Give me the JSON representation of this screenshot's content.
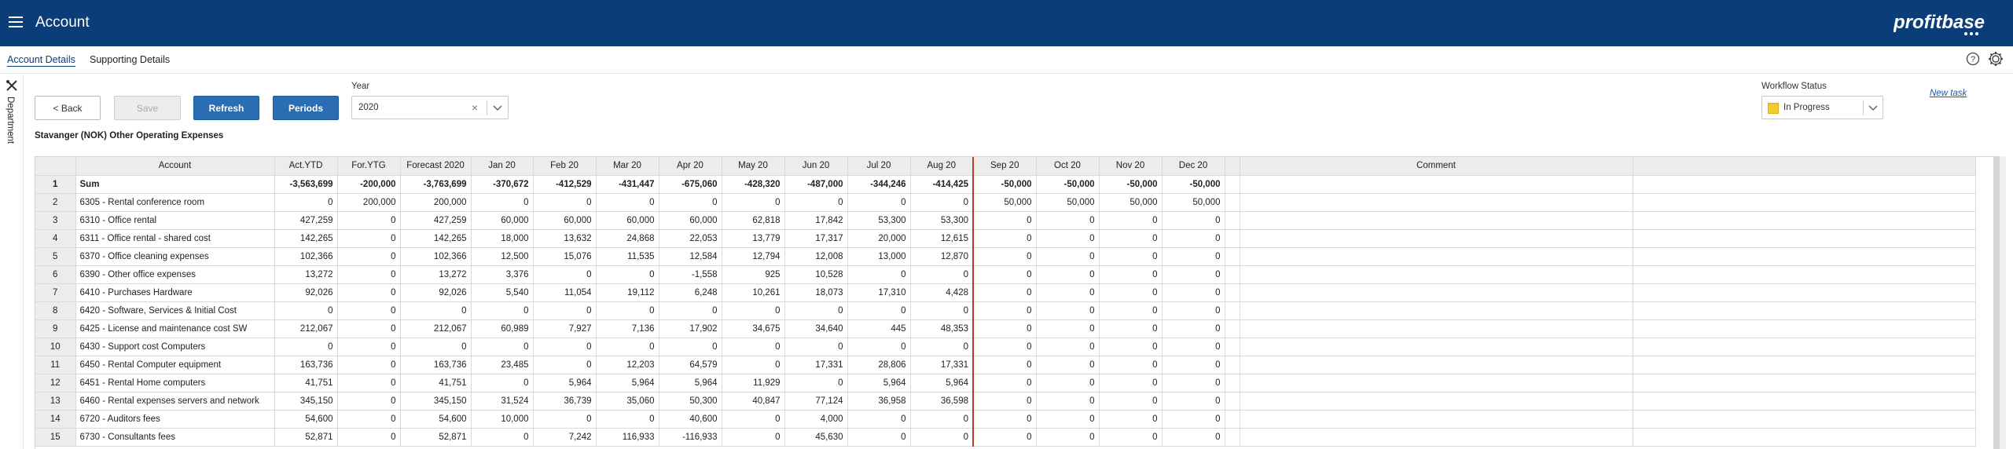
{
  "header": {
    "title": "Account",
    "logo_text": "profitbase"
  },
  "subnav": {
    "tabs": [
      {
        "label": "Account Details",
        "active": true
      },
      {
        "label": "Supporting Details",
        "active": false
      }
    ],
    "icons": [
      "help-icon",
      "gear-icon"
    ]
  },
  "sidepanel": {
    "icon": "tools-icon",
    "label": "Department"
  },
  "toolbar": {
    "back_label": "< Back",
    "save_label": "Save",
    "refresh_label": "Refresh",
    "periods_label": "Periods",
    "year_label": "Year",
    "year_value": "2020",
    "workflow_label": "Workflow Status",
    "workflow_value": "In Progress",
    "workflow_color": "#f2cb2c",
    "new_task_label": "New task"
  },
  "context": "Stavanger (NOK)  Other Operating Expenses",
  "colors": {
    "header_bg": "#0b3d78",
    "primary_button": "#2a6db3",
    "actuals_cutoff_line": "#c0392b"
  },
  "grid": {
    "columns": [
      "",
      "Account",
      "Act.YTD",
      "For.YTG",
      "Forecast 2020",
      "Jan 20",
      "Feb 20",
      "Mar 20",
      "Apr 20",
      "May 20",
      "Jun 20",
      "Jul 20",
      "Aug 20",
      "Sep 20",
      "Oct 20",
      "Nov 20",
      "Dec 20",
      "",
      "Comment",
      ""
    ],
    "rows": [
      [
        "1",
        "Sum",
        "-3,563,699",
        "-200,000",
        "-3,763,699",
        "-370,672",
        "-412,529",
        "-431,447",
        "-675,060",
        "-428,320",
        "-487,000",
        "-344,246",
        "-414,425",
        "-50,000",
        "-50,000",
        "-50,000",
        "-50,000",
        "",
        "",
        ""
      ],
      [
        "2",
        "6305 - Rental conference room",
        "0",
        "200,000",
        "200,000",
        "0",
        "0",
        "0",
        "0",
        "0",
        "0",
        "0",
        "0",
        "50,000",
        "50,000",
        "50,000",
        "50,000",
        "",
        "",
        ""
      ],
      [
        "3",
        "6310 - Office rental",
        "427,259",
        "0",
        "427,259",
        "60,000",
        "60,000",
        "60,000",
        "60,000",
        "62,818",
        "17,842",
        "53,300",
        "53,300",
        "0",
        "0",
        "0",
        "0",
        "",
        "",
        ""
      ],
      [
        "4",
        "6311 - Office rental - shared cost",
        "142,265",
        "0",
        "142,265",
        "18,000",
        "13,632",
        "24,868",
        "22,053",
        "13,779",
        "17,317",
        "20,000",
        "12,615",
        "0",
        "0",
        "0",
        "0",
        "",
        "",
        ""
      ],
      [
        "5",
        "6370 - Office cleaning expenses",
        "102,366",
        "0",
        "102,366",
        "12,500",
        "15,076",
        "11,535",
        "12,584",
        "12,794",
        "12,008",
        "13,000",
        "12,870",
        "0",
        "0",
        "0",
        "0",
        "",
        "",
        ""
      ],
      [
        "6",
        "6390 - Other office expenses",
        "13,272",
        "0",
        "13,272",
        "3,376",
        "0",
        "0",
        "-1,558",
        "925",
        "10,528",
        "0",
        "0",
        "0",
        "0",
        "0",
        "0",
        "",
        "",
        ""
      ],
      [
        "7",
        "6410 - Purchases Hardware",
        "92,026",
        "0",
        "92,026",
        "5,540",
        "11,054",
        "19,112",
        "6,248",
        "10,261",
        "18,073",
        "17,310",
        "4,428",
        "0",
        "0",
        "0",
        "0",
        "",
        "",
        ""
      ],
      [
        "8",
        "6420 - Software, Services & Initial Cost",
        "0",
        "0",
        "0",
        "0",
        "0",
        "0",
        "0",
        "0",
        "0",
        "0",
        "0",
        "0",
        "0",
        "0",
        "0",
        "",
        "",
        ""
      ],
      [
        "9",
        "6425 - License and maintenance cost SW",
        "212,067",
        "0",
        "212,067",
        "60,989",
        "7,927",
        "7,136",
        "17,902",
        "34,675",
        "34,640",
        "445",
        "48,353",
        "0",
        "0",
        "0",
        "0",
        "",
        "",
        ""
      ],
      [
        "10",
        "6430 - Support cost Computers",
        "0",
        "0",
        "0",
        "0",
        "0",
        "0",
        "0",
        "0",
        "0",
        "0",
        "0",
        "0",
        "0",
        "0",
        "0",
        "",
        "",
        ""
      ],
      [
        "11",
        "6450 - Rental Computer equipment",
        "163,736",
        "0",
        "163,736",
        "23,485",
        "0",
        "12,203",
        "64,579",
        "0",
        "17,331",
        "28,806",
        "17,331",
        "0",
        "0",
        "0",
        "0",
        "",
        "",
        ""
      ],
      [
        "12",
        "6451 - Rental Home computers",
        "41,751",
        "0",
        "41,751",
        "0",
        "5,964",
        "5,964",
        "5,964",
        "11,929",
        "0",
        "5,964",
        "5,964",
        "0",
        "0",
        "0",
        "0",
        "",
        "",
        ""
      ],
      [
        "13",
        "6460 - Rental expenses servers and network",
        "345,150",
        "0",
        "345,150",
        "31,524",
        "36,739",
        "35,060",
        "50,300",
        "40,847",
        "77,124",
        "36,958",
        "36,598",
        "0",
        "0",
        "0",
        "0",
        "",
        "",
        ""
      ],
      [
        "14",
        "6720 - Auditors fees",
        "54,600",
        "0",
        "54,600",
        "10,000",
        "0",
        "0",
        "40,600",
        "0",
        "4,000",
        "0",
        "0",
        "0",
        "0",
        "0",
        "0",
        "",
        "",
        ""
      ],
      [
        "15",
        "6730 - Consultants fees",
        "52,871",
        "0",
        "52,871",
        "0",
        "7,242",
        "116,933",
        "-116,933",
        "0",
        "45,630",
        "0",
        "0",
        "0",
        "0",
        "0",
        "0",
        "",
        "",
        ""
      ]
    ]
  }
}
